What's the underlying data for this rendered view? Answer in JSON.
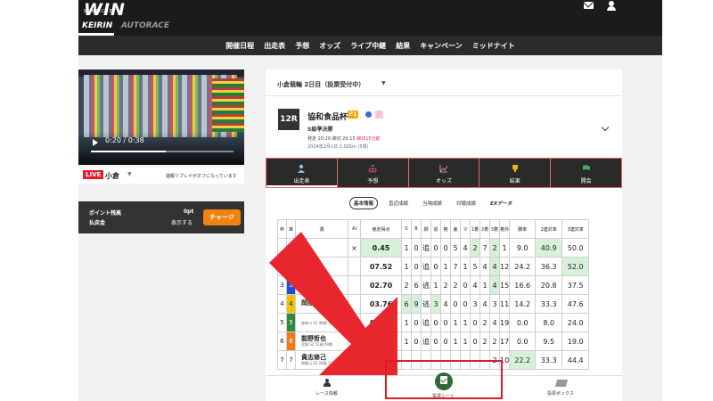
{
  "header": {
    "logo": "WIN",
    "logo_sub": "WINTICKET",
    "tabs": [
      "KEIRIN",
      "AUTORACE"
    ],
    "icons": [
      "mail-icon",
      "user-icon"
    ]
  },
  "nav": [
    "開催日程",
    "出走表",
    "予想",
    "オッズ",
    "ライブ中継",
    "結果",
    "キャンペーン",
    "ミッドナイト"
  ],
  "video": {
    "time": "0:20 / 0:38",
    "progress": 0.526,
    "live_label": "LIVE",
    "venue": "小倉",
    "replay_note": "連報リプレイがオフになっています"
  },
  "points": {
    "label1": "ポイント残高",
    "label2": "払戻金",
    "value1": "0pt",
    "value2": "表示する",
    "charge": "チャージ"
  },
  "race": {
    "select": "小倉競輪 2日目（投票受付中）",
    "number": "12R",
    "name": "協和食品杯",
    "grade": "F1",
    "sub": "S級準決勝",
    "times": "発走 20:20 締切 20:15",
    "deadline": "締切15分前",
    "date": "2024年2月1日 2,025m (5周)"
  },
  "menu_tabs": [
    "出走表",
    "予想",
    "オッズ",
    "結果",
    "開会"
  ],
  "subtabs": [
    "基本情報",
    "直近成績",
    "当場成績",
    "対戦成績",
    "EXデータ"
  ],
  "table": {
    "headers": [
      "枠",
      "車",
      "選",
      "AI",
      "競走得点",
      "S",
      "B",
      "脚",
      "逃",
      "捲",
      "差",
      "マ",
      "1着",
      "2着",
      "3着",
      "着外",
      "勝率",
      "2連対率",
      "3連対率"
    ],
    "rows": [
      {
        "frame": "",
        "car": "",
        "name": "",
        "meta": "",
        "ai": "×",
        "score": "0.45",
        "c": [
          "1",
          "0",
          "追",
          "0",
          "0",
          "5",
          "4",
          "2",
          "7",
          "2",
          "1"
        ],
        "win": "9.0",
        "r2": "40.9",
        "r3": "50.0",
        "hl": [
          7,
          9
        ]
      },
      {
        "frame": "",
        "car": "",
        "name": "",
        "meta": "",
        "ai": "",
        "score": "07.52",
        "c": [
          "1",
          "0",
          "追",
          "0",
          "1",
          "7",
          "1",
          "5",
          "4",
          "4",
          "12"
        ],
        "win": "24.2",
        "r2": "36.3",
        "r3": "52.0",
        "hl": [
          9
        ]
      },
      {
        "frame": "3",
        "car": "3",
        "name": "",
        "meta": "",
        "ai": "",
        "score": "02.70",
        "c": [
          "2",
          "6",
          "逃",
          "1",
          "2",
          "2",
          "0",
          "4",
          "1",
          "4",
          "15"
        ],
        "win": "16.6",
        "r2": "20.8",
        "r3": "37.5",
        "hl": [
          9
        ]
      },
      {
        "frame": "4",
        "car": "4",
        "name": "岡部",
        "meta": "",
        "ai": "",
        "score": "03.76",
        "c": [
          "6",
          "9",
          "逃",
          "3",
          "4",
          "0",
          "0",
          "3",
          "4",
          "3",
          "11"
        ],
        "win": "14.2",
        "r2": "33.3",
        "r3": "47.6",
        "hl": [
          0,
          1,
          3
        ]
      },
      {
        "frame": "5",
        "car": "5",
        "name": "",
        "meta": "神奈川 S2 48期 75期",
        "ai": "",
        "score": "98.44",
        "c": [
          "1",
          "0",
          "追",
          "0",
          "0",
          "1",
          "1",
          "0",
          "2",
          "4",
          "19"
        ],
        "win": "0.0",
        "r2": "8.0",
        "r3": "24.0",
        "hl": []
      },
      {
        "frame": "6",
        "car": "6",
        "name": "能野哲也",
        "meta": "宮城 S2 51歳 69期",
        "ai": "",
        "score": "96.00",
        "c": [
          "1",
          "0",
          "追",
          "0",
          "0",
          "1",
          "1",
          "0",
          "2",
          "2",
          "17"
        ],
        "win": "0.0",
        "r2": "9.5",
        "r3": "19.0",
        "hl": []
      },
      {
        "frame": "7",
        "car": "7",
        "name": "貴志修己",
        "meta": "和歌山 S2 28歳 117期",
        "ai": "○",
        "score": "103",
        "c": [
          "",
          "",
          "",
          "",
          "",
          "",
          "",
          "",
          "",
          "2",
          "10"
        ],
        "win": "22.2",
        "r2": "33.3",
        "r3": "44.4",
        "hl": []
      }
    ]
  },
  "colors": {
    "frame": [
      "#ffffff",
      "#1a1a1a",
      "#e51d2b",
      "#1d4ed8",
      "#f4c20d",
      "#2e8b3e",
      "#f07a1a"
    ],
    "frame_text": [
      "#222",
      "#fff",
      "#fff",
      "#fff",
      "#222",
      "#fff",
      "#fff"
    ],
    "accent": "#e01b24",
    "orange": "#f0820f"
  },
  "bottom_nav": {
    "items": [
      "レース情報",
      "投票シート",
      "投票ボックス"
    ]
  }
}
